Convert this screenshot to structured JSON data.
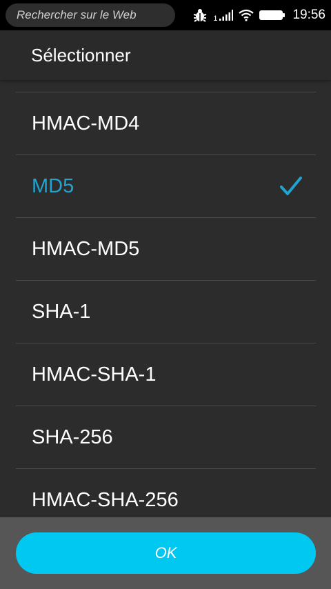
{
  "status_bar": {
    "search_placeholder": "Rechercher sur le Web",
    "sim_number": "1",
    "time": "19:56",
    "icons": [
      "bug-icon",
      "signal-icon",
      "wifi-icon",
      "battery-icon"
    ]
  },
  "dialog": {
    "title": "Sélectionner",
    "items": [
      {
        "label": "HMAC-MD4",
        "selected": false
      },
      {
        "label": "MD5",
        "selected": true
      },
      {
        "label": "HMAC-MD5",
        "selected": false
      },
      {
        "label": "SHA-1",
        "selected": false
      },
      {
        "label": "HMAC-SHA-1",
        "selected": false
      },
      {
        "label": "SHA-256",
        "selected": false
      },
      {
        "label": "HMAC-SHA-256",
        "selected": false
      }
    ],
    "ok_label": "OK"
  },
  "colors": {
    "accent": "#1fa5cf",
    "button": "#00c8f0",
    "background": "#2c2c2c",
    "footer": "#565656"
  }
}
